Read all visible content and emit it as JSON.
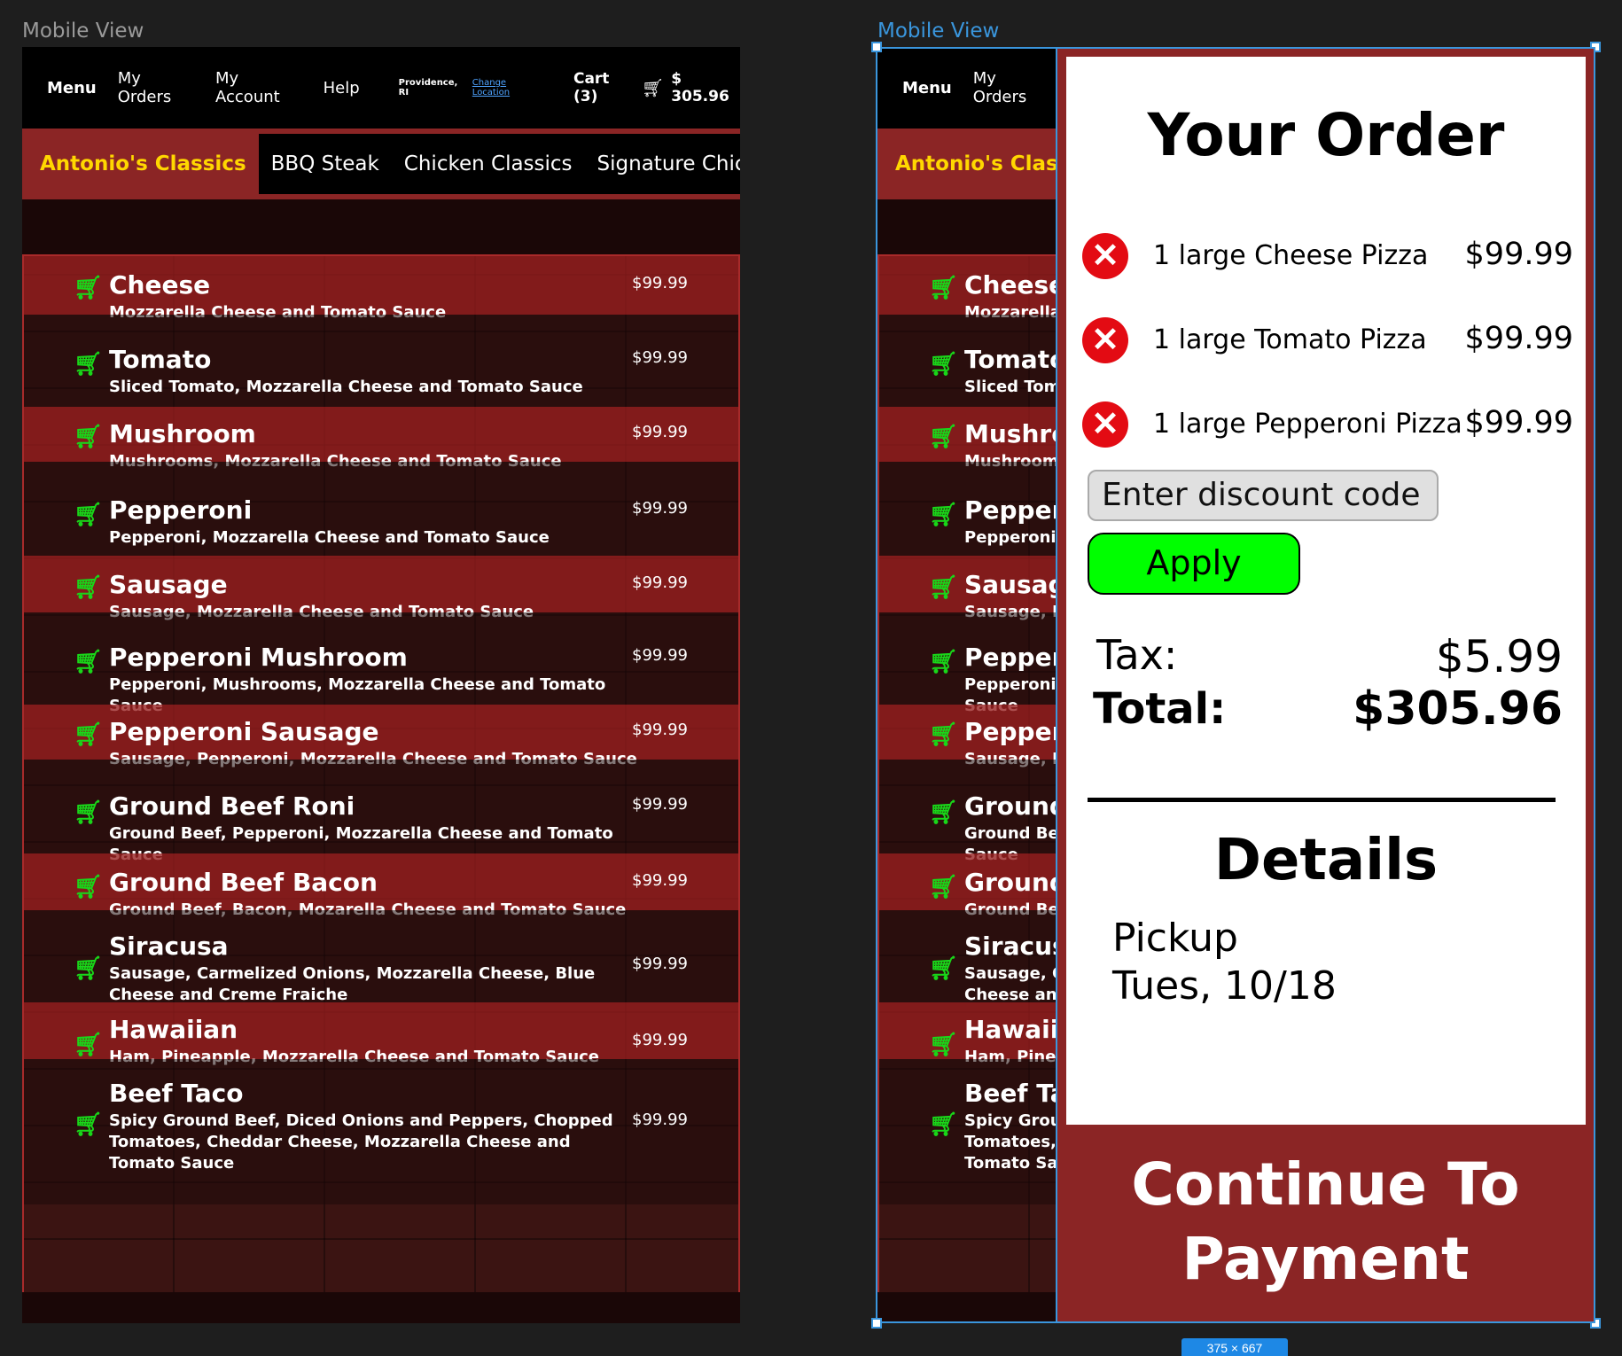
{
  "canvas": {
    "left_label": "Mobile View",
    "right_label": "Mobile View",
    "dimension_badge": "375 × 667"
  },
  "nav": {
    "menu": "Menu",
    "my_orders": "My Orders",
    "my_account": "My Account",
    "help": "Help",
    "location": "Providence, RI",
    "change_location": "Change Location",
    "cart": "Cart (3)",
    "cart_icon": "shopping-cart-icon",
    "cart_total": "$ 305.96"
  },
  "categories": {
    "active": "Antonio's Classics",
    "others": [
      "BBQ Steak",
      "Chicken Classics",
      "Signature Chicken"
    ]
  },
  "menu_items": [
    {
      "name": "Cheese",
      "desc": "Mozzarella Cheese and Tomato Sauce",
      "price": "$99.99"
    },
    {
      "name": "Tomato",
      "desc": "Sliced Tomato, Mozzarella Cheese and Tomato Sauce",
      "price": "$99.99"
    },
    {
      "name": "Mushroom",
      "desc": "Mushrooms, Mozzarella Cheese and Tomato Sauce",
      "price": "$99.99"
    },
    {
      "name": "Pepperoni",
      "desc": "Pepperoni, Mozzarella Cheese and Tomato Sauce",
      "price": "$99.99"
    },
    {
      "name": "Sausage",
      "desc": "Sausage, Mozzarella Cheese and Tomato Sauce",
      "price": "$99.99"
    },
    {
      "name": "Pepperoni Mushroom",
      "desc": "Pepperoni, Mushrooms, Mozzarella Cheese and Tomato Sauce",
      "price": "$99.99"
    },
    {
      "name": "Pepperoni Sausage",
      "desc": "Sausage, Pepperoni, Mozzarella Cheese and Tomato Sauce",
      "price": "$99.99"
    },
    {
      "name": "Ground Beef Roni",
      "desc": "Ground Beef, Pepperoni, Mozzarella Cheese and Tomato Sauce",
      "price": "$99.99"
    },
    {
      "name": "Ground Beef Bacon",
      "desc": "Ground Beef, Bacon, Mozarella Cheese and Tomato Sauce",
      "price": "$99.99"
    },
    {
      "name": "Siracusa",
      "desc": "Sausage, Carmelized Onions, Mozzarella Cheese, Blue Cheese and Creme Fraiche",
      "price": "$99.99"
    },
    {
      "name": "Hawaiian",
      "desc": "Ham, Pineapple, Mozzarella Cheese and Tomato Sauce",
      "price": "$99.99"
    },
    {
      "name": "Beef Taco",
      "desc": "Spicy Ground Beef, Diced Onions and Peppers, Chopped Tomatoes, Cheddar Cheese, Mozzarella Cheese and Tomato Sauce",
      "price": "$99.99"
    }
  ],
  "order": {
    "title": "Your Order",
    "items": [
      {
        "name": "1 large Cheese Pizza",
        "price": "$99.99"
      },
      {
        "name": "1 large Tomato Pizza",
        "price": "$99.99"
      },
      {
        "name": "1 large Pepperoni Pizza",
        "price": "$99.99"
      }
    ],
    "discount_placeholder": "Enter discount code",
    "apply_label": "Apply",
    "tax_label": "Tax:",
    "tax_value": "$5.99",
    "total_label": "Total:",
    "total_value": "$305.96",
    "details_title": "Details",
    "pickup_label": "Pickup",
    "pickup_date": "Tues, 10/18",
    "continue_label": "Continue To Payment"
  },
  "colors": {
    "brand_red": "#8b2525",
    "accent_yellow": "#ffd700",
    "cart_green": "#19d619",
    "apply_green": "#00ff00",
    "remove_red": "#e30b13",
    "selection_blue": "#3a96dd"
  }
}
